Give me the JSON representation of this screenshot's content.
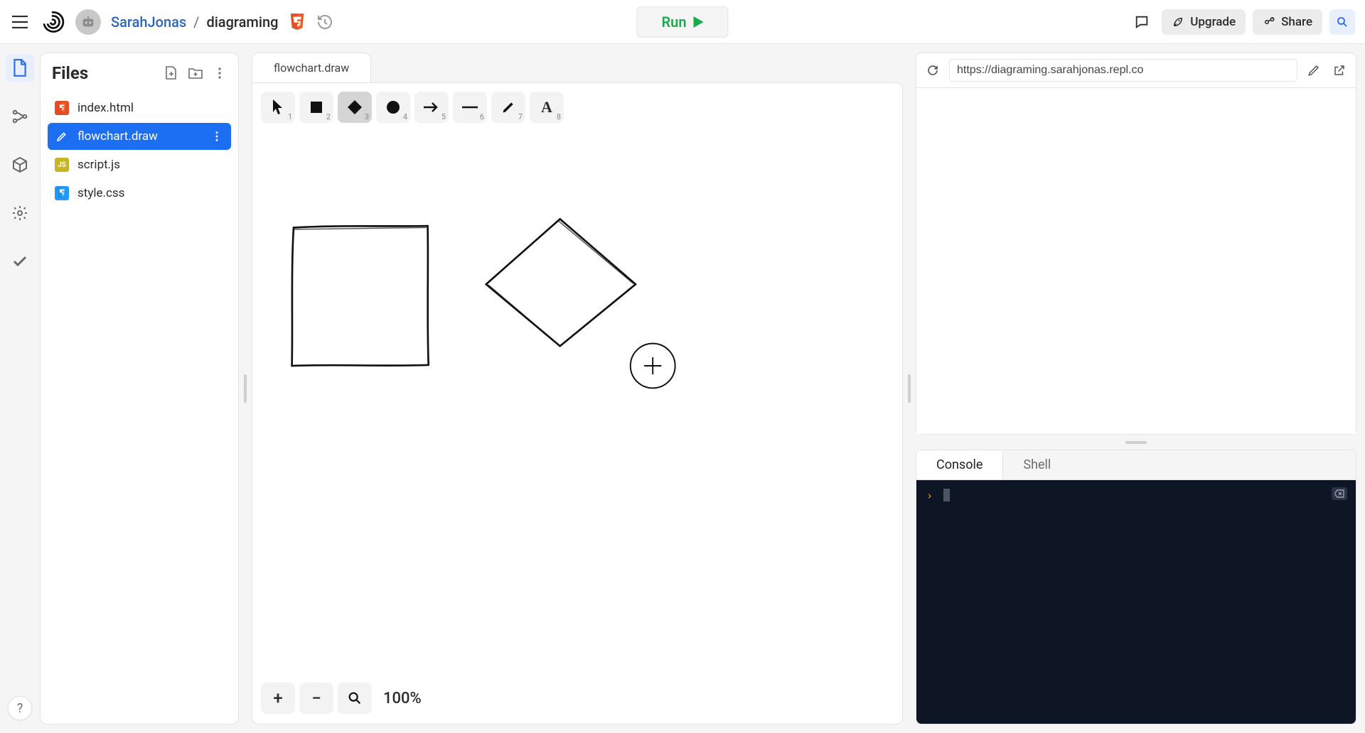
{
  "header": {
    "user": "SarahJonas",
    "separator": "/",
    "repl": "diagraming",
    "run_label": "Run",
    "upgrade_label": "Upgrade",
    "share_label": "Share"
  },
  "rail": {
    "items": [
      "files",
      "version-control",
      "packages",
      "settings",
      "done"
    ]
  },
  "files_panel": {
    "title": "Files",
    "items": [
      {
        "name": "index.html",
        "kind": "html",
        "selected": false
      },
      {
        "name": "flowchart.draw",
        "kind": "draw",
        "selected": true
      },
      {
        "name": "script.js",
        "kind": "js",
        "selected": false
      },
      {
        "name": "style.css",
        "kind": "css",
        "selected": false
      }
    ]
  },
  "editor": {
    "open_tab": "flowchart.draw",
    "toolbar": [
      {
        "name": "select",
        "hotkey": "1",
        "selected": false
      },
      {
        "name": "rectangle",
        "hotkey": "2",
        "selected": false
      },
      {
        "name": "diamond",
        "hotkey": "3",
        "selected": true
      },
      {
        "name": "ellipse",
        "hotkey": "4",
        "selected": false
      },
      {
        "name": "arrow",
        "hotkey": "5",
        "selected": false
      },
      {
        "name": "line",
        "hotkey": "6",
        "selected": false
      },
      {
        "name": "draw",
        "hotkey": "7",
        "selected": false
      },
      {
        "name": "text",
        "hotkey": "8",
        "selected": false
      }
    ],
    "zoom_label": "100%"
  },
  "webview": {
    "url": "https://diagraming.sarahjonas.repl.co"
  },
  "console": {
    "tabs": [
      {
        "label": "Console",
        "active": true
      },
      {
        "label": "Shell",
        "active": false
      }
    ],
    "prompt": "›"
  }
}
